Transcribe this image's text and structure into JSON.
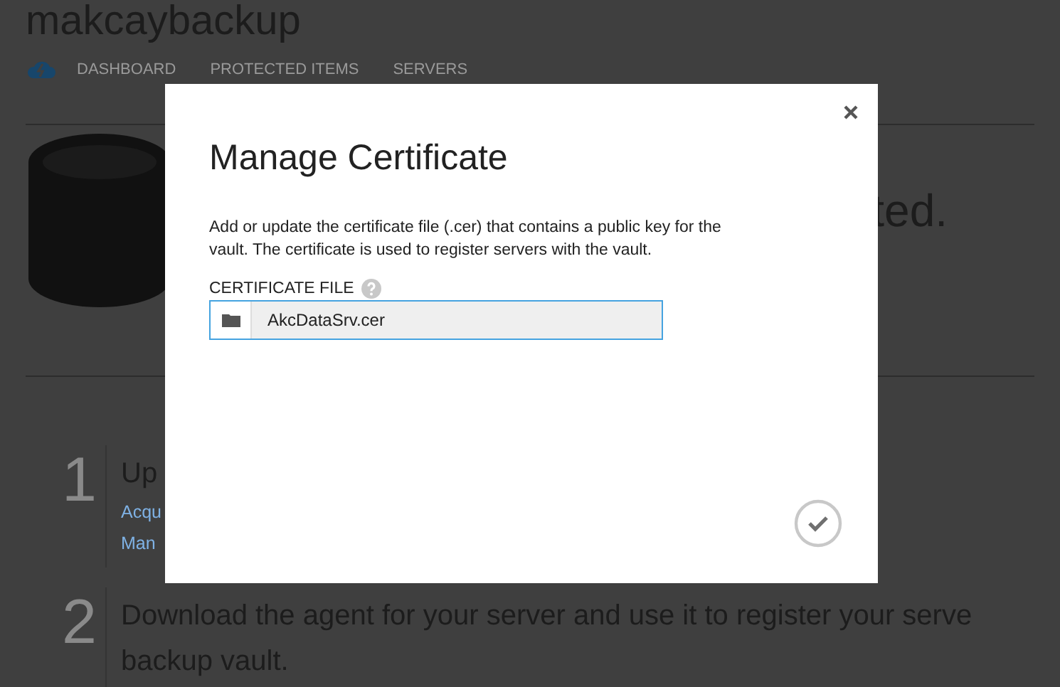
{
  "page": {
    "title": "makcaybackup",
    "nav": [
      {
        "label": "DASHBOARD"
      },
      {
        "label": "PROTECTED ITEMS"
      },
      {
        "label": "SERVERS"
      }
    ],
    "headline_fragment": "ted.",
    "steps": [
      {
        "number": "1",
        "lines": [
          "Up"
        ],
        "links": [
          "Acqu",
          "Man"
        ]
      },
      {
        "number": "2",
        "lines": [
          "Download the agent for your server and use it to register your serve",
          "backup vault."
        ]
      }
    ]
  },
  "dialog": {
    "title": "Manage Certificate",
    "description": "Add or update the certificate file (.cer) that contains a public key for the vault. The certificate is used to register servers with the vault.",
    "field": {
      "label": "CERTIFICATE FILE",
      "value": "AkcDataSrv.cer"
    }
  }
}
